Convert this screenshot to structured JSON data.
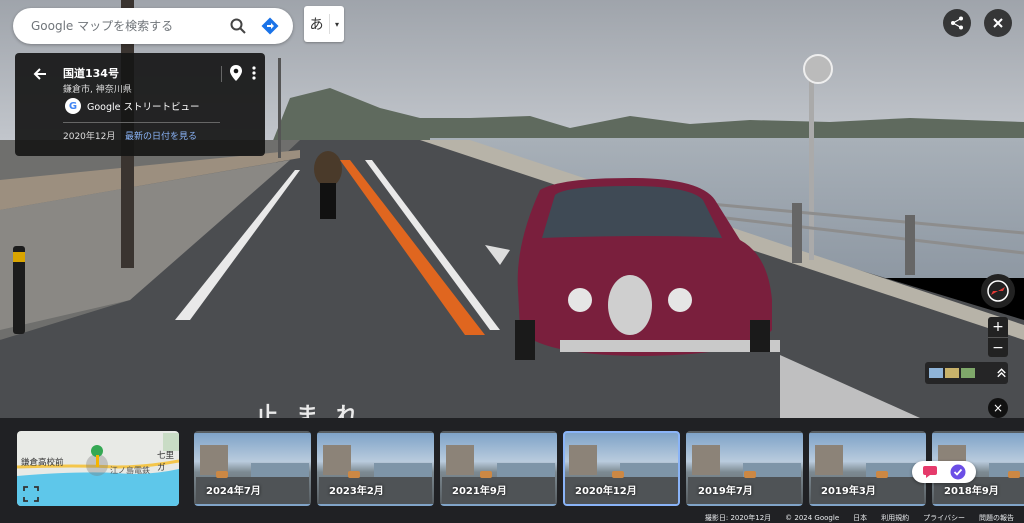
{
  "search": {
    "placeholder": "Google マップを検索する"
  },
  "ime": {
    "char": "あ",
    "dropdown": "▾"
  },
  "info_panel": {
    "title": "国道134号",
    "subtitle": "鎌倉市, 神奈川県",
    "source": "Google ストリートビュー",
    "date": "2020年12月",
    "latest_link": "最新の日付を見る"
  },
  "road_marking": "止まれ",
  "timeline": {
    "minimap": {
      "station_label": "鎌倉高校前",
      "place_label": "七里ガ",
      "line_label": "江ノ島電鉄"
    },
    "thumbnails": [
      {
        "label": "2024年7月",
        "active": false
      },
      {
        "label": "2023年2月",
        "active": false
      },
      {
        "label": "2021年9月",
        "active": false
      },
      {
        "label": "2020年12月",
        "active": true
      },
      {
        "label": "2019年7月",
        "active": false
      },
      {
        "label": "2019年3月",
        "active": false
      },
      {
        "label": "2018年9月",
        "active": false
      }
    ]
  },
  "footer": {
    "capture_date": "撮影日: 2020年12月",
    "copyright": "© 2024 Google",
    "country": "日本",
    "terms": "利用規約",
    "privacy": "プライバシー",
    "report": "問題の報告"
  },
  "zoom": {
    "plus": "+",
    "minus": "−"
  },
  "close_symbol": "×",
  "colors": {
    "panel_bg": "#161616",
    "link_blue": "#8ab4f8",
    "timeline_bg": "#202124",
    "car": "#7a1f3d"
  }
}
